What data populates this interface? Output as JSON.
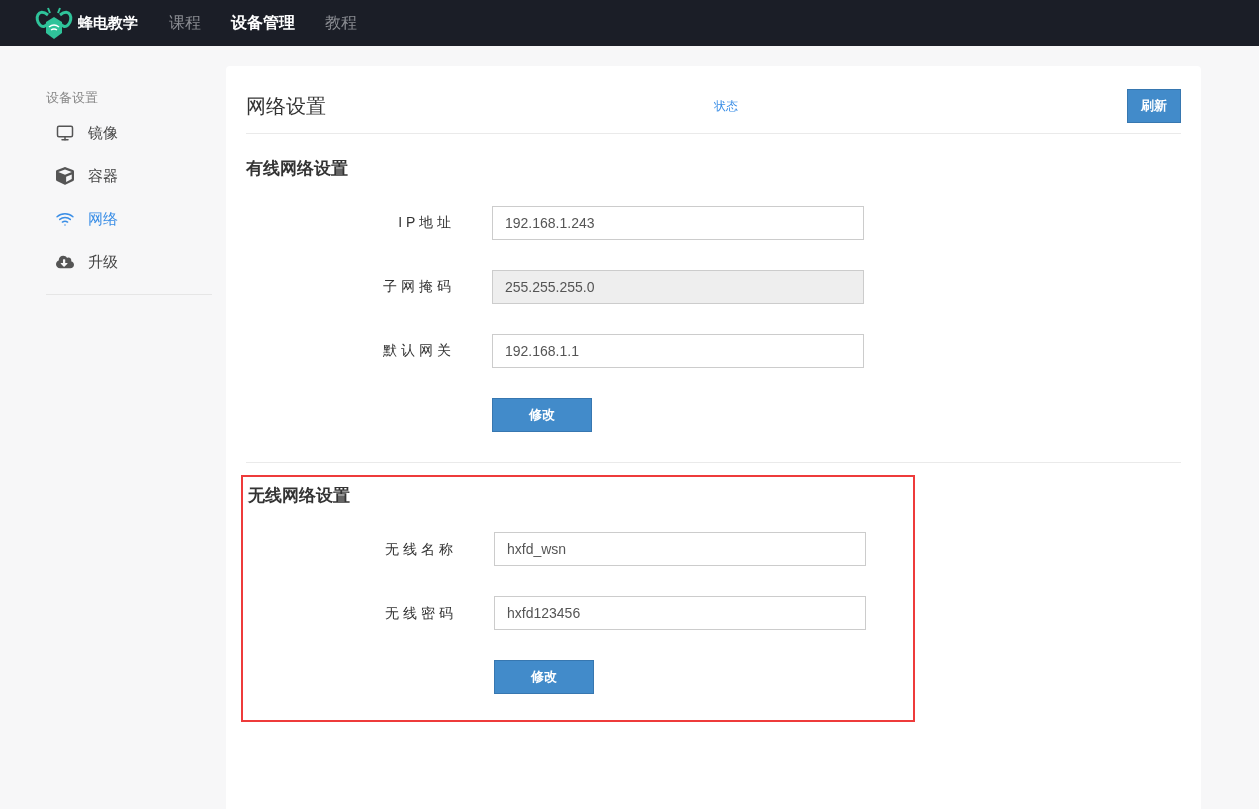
{
  "navbar": {
    "brand": "蜂电教学",
    "links": [
      {
        "label": "课程",
        "selected": false
      },
      {
        "label": "设备管理",
        "selected": true
      },
      {
        "label": "教程",
        "selected": false
      }
    ]
  },
  "sidebar": {
    "heading": "设备设置",
    "items": [
      {
        "kind": "monitor",
        "label": "镜像",
        "selected": false
      },
      {
        "kind": "box",
        "label": "容器",
        "selected": false
      },
      {
        "kind": "wifi",
        "label": "网络",
        "selected": true
      },
      {
        "kind": "upload",
        "label": "升级",
        "selected": false
      }
    ]
  },
  "panel": {
    "title": "网络设置",
    "status_link": "状态",
    "refresh_button": "刷新",
    "sections": [
      {
        "title": "有线网络设置",
        "highlighted": false,
        "fields": [
          {
            "label": "I P 地 址",
            "value": "192.168.1.243",
            "disabled": false
          },
          {
            "label": "子 网 掩 码",
            "value": "255.255.255.0",
            "disabled": true
          },
          {
            "label": "默 认 网 关",
            "value": "192.168.1.1",
            "disabled": false
          }
        ],
        "button": "修改"
      },
      {
        "title": "无线网络设置",
        "highlighted": true,
        "fields": [
          {
            "label": "无 线 名 称",
            "value": "hxfd_wsn",
            "disabled": false
          },
          {
            "label": "无 线 密 码",
            "value": "hxfd123456",
            "disabled": false
          }
        ],
        "button": "修改"
      }
    ]
  }
}
